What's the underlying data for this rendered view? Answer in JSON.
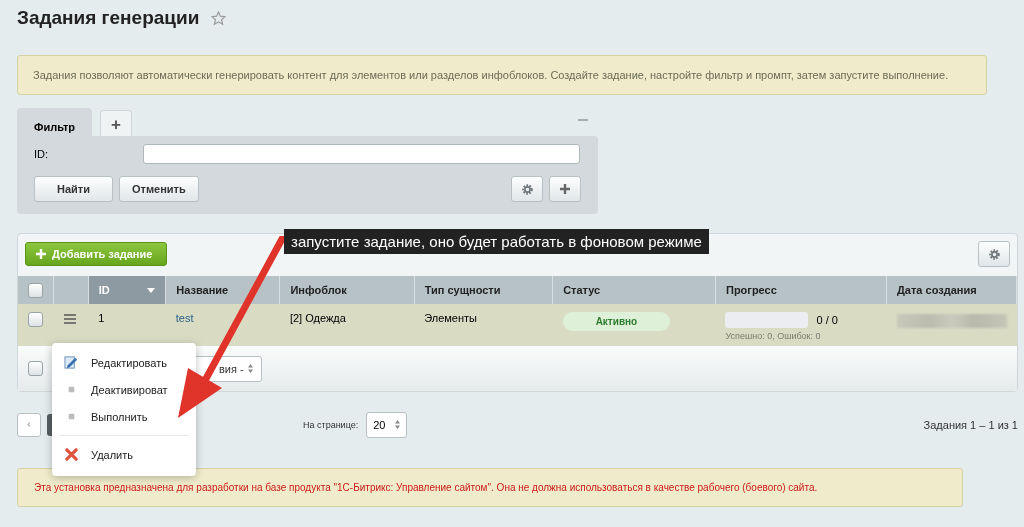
{
  "title": "Задания генерации",
  "info": "Задания позволяют автоматически генерировать контент для элементов или разделов инфоблоков. Создайте задание, настройте фильтр и промпт, затем запустите выполнение.",
  "filter": {
    "tabs": [
      {
        "label": "Фильтр",
        "selected": true
      },
      {
        "label": "+",
        "selected": false
      }
    ],
    "fields": [
      {
        "label": "ID:"
      }
    ],
    "buttons": [
      "Найти",
      "Отменить"
    ]
  },
  "table": {
    "add_button": "Добавить задание",
    "header_checked": false,
    "footer_checked": false,
    "columns": [
      {
        "label": "ID",
        "sorted": true
      },
      {
        "label": "Название",
        "sorted": false
      },
      {
        "label": "Инфоблок",
        "sorted": false
      },
      {
        "label": "Тип сущности",
        "sorted": false
      },
      {
        "label": "Статус",
        "sorted": false
      },
      {
        "label": "Прогресс",
        "sorted": false
      },
      {
        "label": "Дата создания",
        "sorted": false
      }
    ],
    "rows": [
      {
        "checked": false,
        "id": "1",
        "name": "test",
        "iblock": "[2] Одежда",
        "entity": "Элементы",
        "status": "Активно",
        "level": 0,
        "count": "0 / 0",
        "summary": "Успешно: 0, Ошибок: 0"
      }
    ],
    "action_select": "вия -"
  },
  "context_menu": [
    {
      "kind": "edit",
      "label": "Редактировать"
    },
    {
      "kind": "dot",
      "label": "Деактивироват"
    },
    {
      "kind": "dot",
      "label": "Выполнить"
    },
    {
      "kind": "delete",
      "label": "Удалить"
    }
  ],
  "pagination": {
    "per_page_label": "На странице:",
    "per_page": "20",
    "summary": "Задания 1 – 1 из 1"
  },
  "tooltip": "запустите задание, оно будет работать в фоновом режиме",
  "warning": "Эта установка предназначена для разработки на базе продукта \"1С-Битрикс: Управление сайтом\". Она не должна использоваться в качестве рабочего (боевого) сайта."
}
